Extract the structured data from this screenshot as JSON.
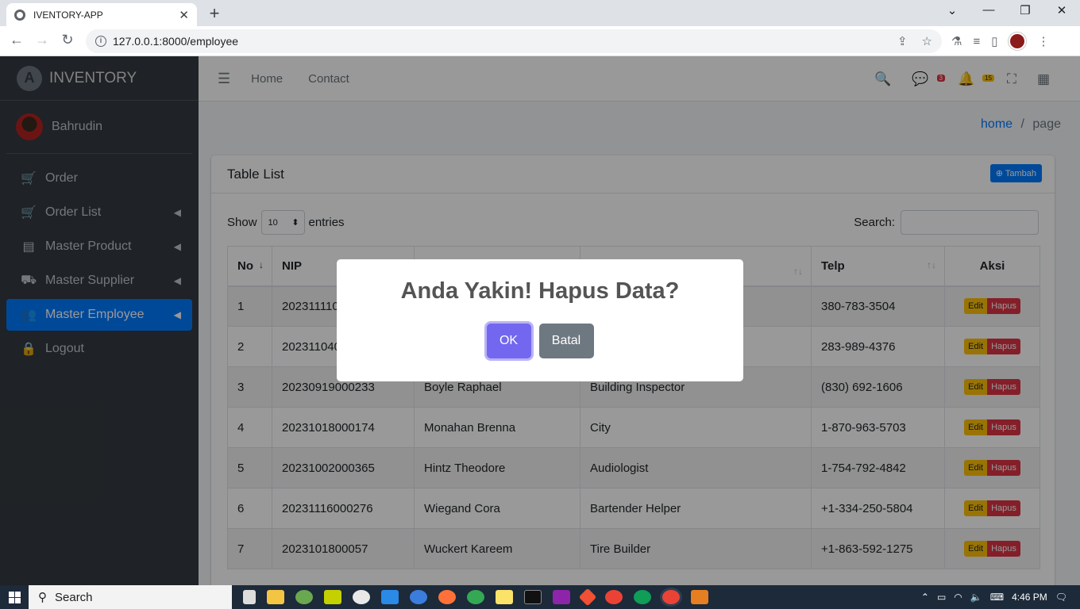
{
  "browser": {
    "tab_title": "IVENTORY-APP",
    "url": "127.0.0.1:8000/employee"
  },
  "sidebar": {
    "brand": "INVENTORY",
    "brand_logo": "A",
    "user": "Bahrudin",
    "items": [
      {
        "label": "Order",
        "icon": "cart-icon"
      },
      {
        "label": "Order List",
        "icon": "cart-icon"
      },
      {
        "label": "Master Product",
        "icon": "book-icon"
      },
      {
        "label": "Master Supplier",
        "icon": "truck-icon"
      },
      {
        "label": "Master Employee",
        "icon": "users-icon"
      },
      {
        "label": "Logout",
        "icon": "lock-icon"
      }
    ]
  },
  "topnav": {
    "links": [
      "Home",
      "Contact"
    ],
    "messages_badge": "3",
    "notifications_badge": "15"
  },
  "breadcrumb": {
    "home": "home",
    "separator": "/",
    "current": "page"
  },
  "card": {
    "title": "Table List",
    "add_button": "Tambah",
    "show_label": "Show",
    "entries_value": "10",
    "entries_label": "entries",
    "search_label": "Search:"
  },
  "table": {
    "headers": [
      "No",
      "NIP",
      "",
      "",
      "Telp",
      "Aksi"
    ],
    "edit_label": "Edit",
    "delete_label": "Hapus",
    "rows": [
      [
        "1",
        "2023111104",
        "",
        "",
        "380-783-3504"
      ],
      [
        "2",
        "2023110400",
        "",
        "",
        "283-989-4376"
      ],
      [
        "3",
        "20230919000233",
        "Boyle Raphael",
        "Building Inspector",
        "(830) 692-1606"
      ],
      [
        "4",
        "20231018000174",
        "Monahan Brenna",
        "City",
        "1-870-963-5703"
      ],
      [
        "5",
        "20231002000365",
        "Hintz Theodore",
        "Audiologist",
        "1-754-792-4842"
      ],
      [
        "6",
        "20231116000276",
        "Wiegand Cora",
        "Bartender Helper",
        "+1-334-250-5804"
      ],
      [
        "7",
        "2023101800057",
        "Wuckert Kareem",
        "Tire Builder",
        "+1-863-592-1275"
      ]
    ]
  },
  "modal": {
    "title": "Anda Yakin! Hapus Data?",
    "ok": "OK",
    "cancel": "Batal"
  },
  "taskbar": {
    "search": "Search",
    "time": "4:46 PM"
  }
}
